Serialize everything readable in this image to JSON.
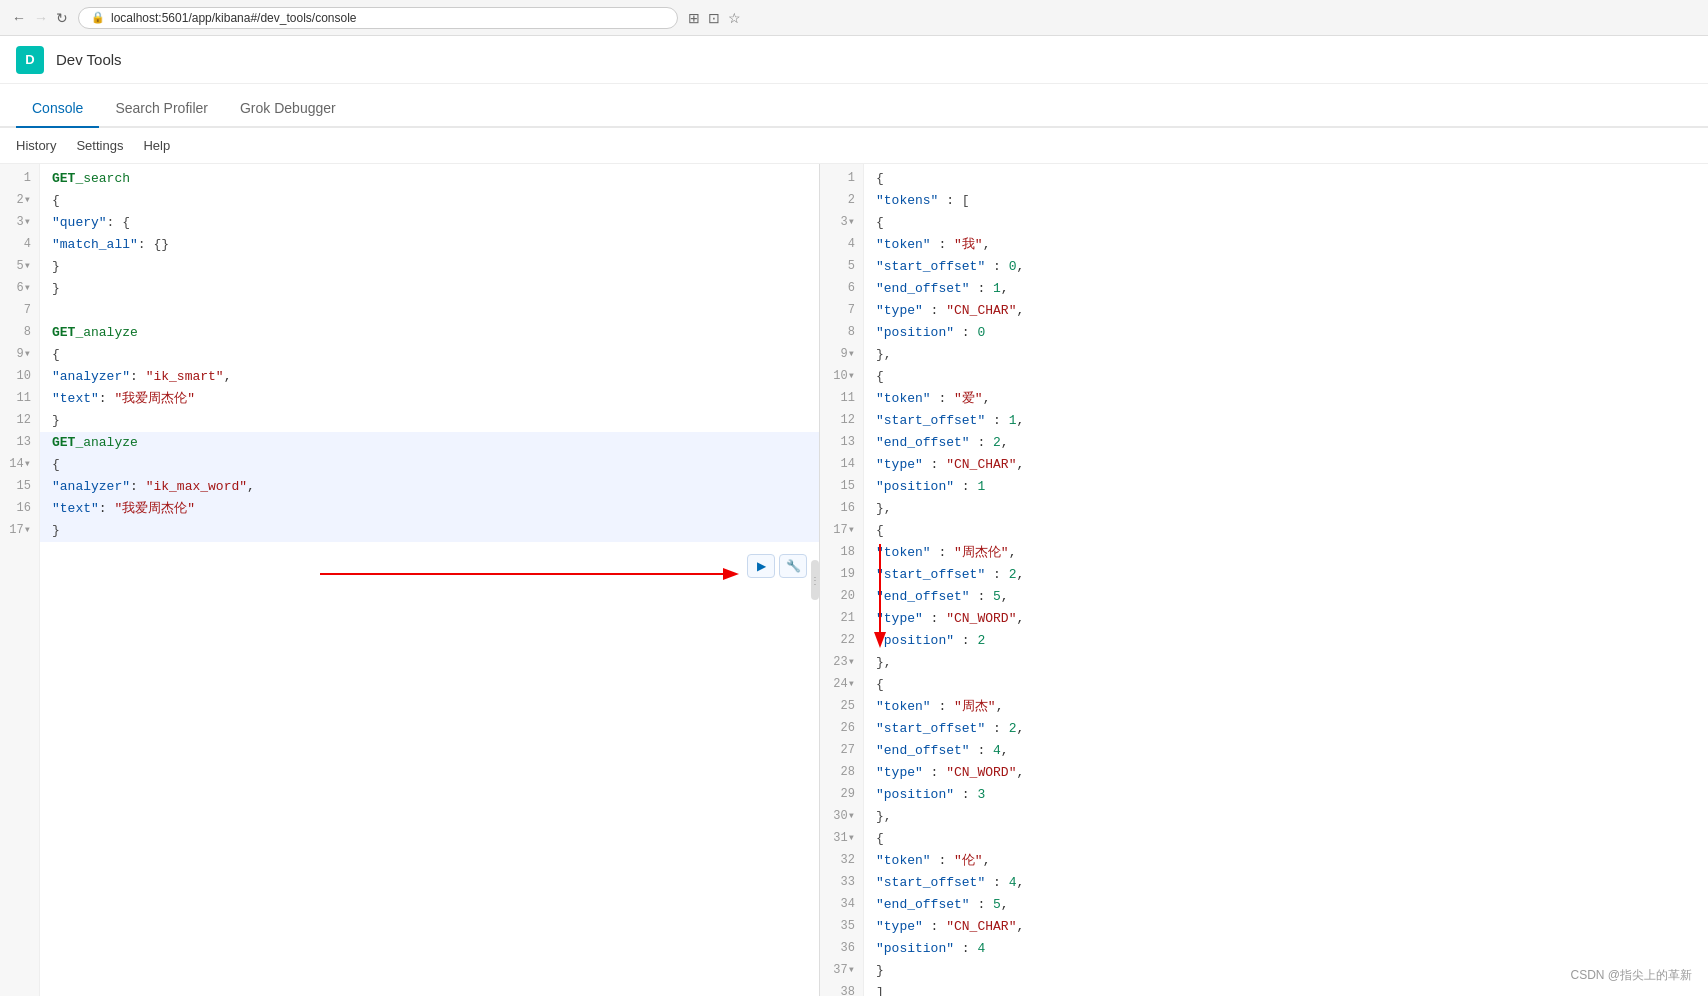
{
  "browser": {
    "url": "localhost:5601/app/kibana#/dev_tools/console",
    "back_icon": "←",
    "forward_icon": "→",
    "refresh_icon": "↻",
    "lock_icon": "🔒",
    "translate_icon": "⊞",
    "share_icon": "⊡",
    "star_icon": "☆"
  },
  "app": {
    "logo_letter": "D",
    "title": "Dev Tools"
  },
  "tabs": [
    {
      "id": "console",
      "label": "Console",
      "active": true
    },
    {
      "id": "search-profiler",
      "label": "Search Profiler",
      "active": false
    },
    {
      "id": "grok-debugger",
      "label": "Grok Debugger",
      "active": false
    }
  ],
  "toolbar": {
    "items": [
      "History",
      "Settings",
      "Help"
    ]
  },
  "editor": {
    "run_button_label": "▶",
    "settings_button_label": "⚙",
    "lines": [
      {
        "num": "1",
        "content": "GET _search",
        "type": "method"
      },
      {
        "num": "2▼",
        "content": "{",
        "type": "brace"
      },
      {
        "num": "3▼",
        "content": "  \"query\": {",
        "type": "code"
      },
      {
        "num": "4",
        "content": "    \"match_all\": {}",
        "type": "code"
      },
      {
        "num": "5▼",
        "content": "  }",
        "type": "code"
      },
      {
        "num": "6▼",
        "content": "}",
        "type": "brace"
      },
      {
        "num": "7",
        "content": "",
        "type": "empty"
      },
      {
        "num": "8",
        "content": "GET _analyze",
        "type": "method"
      },
      {
        "num": "9▼",
        "content": "{",
        "type": "brace"
      },
      {
        "num": "10",
        "content": "  \"analyzer\": \"ik_smart\",",
        "type": "code"
      },
      {
        "num": "11",
        "content": "  \"text\": \"我爱周杰伦\"",
        "type": "code"
      },
      {
        "num": "12",
        "content": "}",
        "type": "brace"
      },
      {
        "num": "13",
        "content": "GET _analyze",
        "type": "method",
        "highlighted": true
      },
      {
        "num": "14▼",
        "content": "{",
        "type": "brace",
        "highlighted": true
      },
      {
        "num": "15",
        "content": "  \"analyzer\": \"ik_max_word\",",
        "type": "code",
        "highlighted": true
      },
      {
        "num": "16",
        "content": "  \"text\": \"我爱周杰伦\"",
        "type": "code",
        "highlighted": true
      },
      {
        "num": "17▼",
        "content": "}",
        "type": "brace",
        "highlighted": true
      }
    ]
  },
  "output": {
    "lines": [
      {
        "num": "1",
        "content": "{"
      },
      {
        "num": "2",
        "content": "  \"tokens\" : ["
      },
      {
        "num": "3▼",
        "content": "    {"
      },
      {
        "num": "4",
        "content": "      \"token\" : \"我\","
      },
      {
        "num": "5",
        "content": "      \"start_offset\" : 0,"
      },
      {
        "num": "6",
        "content": "      \"end_offset\" : 1,"
      },
      {
        "num": "7",
        "content": "      \"type\" : \"CN_CHAR\","
      },
      {
        "num": "8",
        "content": "      \"position\" : 0"
      },
      {
        "num": "9▼",
        "content": "    },"
      },
      {
        "num": "10▼",
        "content": "    {"
      },
      {
        "num": "11",
        "content": "      \"token\" : \"爱\","
      },
      {
        "num": "12",
        "content": "      \"start_offset\" : 1,"
      },
      {
        "num": "13",
        "content": "      \"end_offset\" : 2,"
      },
      {
        "num": "14",
        "content": "      \"type\" : \"CN_CHAR\","
      },
      {
        "num": "15",
        "content": "      \"position\" : 1"
      },
      {
        "num": "16",
        "content": "    },"
      },
      {
        "num": "17▼",
        "content": "    {"
      },
      {
        "num": "18",
        "content": "      \"token\" : \"周杰伦\","
      },
      {
        "num": "19",
        "content": "      \"start_offset\" : 2,"
      },
      {
        "num": "20",
        "content": "      \"end_offset\" : 5,"
      },
      {
        "num": "21",
        "content": "      \"type\" : \"CN_WORD\","
      },
      {
        "num": "22",
        "content": "      \"position\" : 2"
      },
      {
        "num": "23▼",
        "content": "    },"
      },
      {
        "num": "24▼",
        "content": "    {"
      },
      {
        "num": "25",
        "content": "      \"token\" : \"周杰\","
      },
      {
        "num": "26",
        "content": "      \"start_offset\" : 2,"
      },
      {
        "num": "27",
        "content": "      \"end_offset\" : 4,"
      },
      {
        "num": "28",
        "content": "      \"type\" : \"CN_WORD\","
      },
      {
        "num": "29",
        "content": "      \"position\" : 3"
      },
      {
        "num": "30▼",
        "content": "    },"
      },
      {
        "num": "31▼",
        "content": "    {"
      },
      {
        "num": "32",
        "content": "      \"token\" : \"伦\","
      },
      {
        "num": "33",
        "content": "      \"start_offset\" : 4,"
      },
      {
        "num": "34",
        "content": "      \"end_offset\" : 5,"
      },
      {
        "num": "35",
        "content": "      \"type\" : \"CN_CHAR\","
      },
      {
        "num": "36",
        "content": "      \"position\" : 4"
      },
      {
        "num": "37▼",
        "content": "    }"
      },
      {
        "num": "38",
        "content": "  ]"
      }
    ]
  },
  "watermark": {
    "text": "CSDN @指尖上的革新"
  }
}
